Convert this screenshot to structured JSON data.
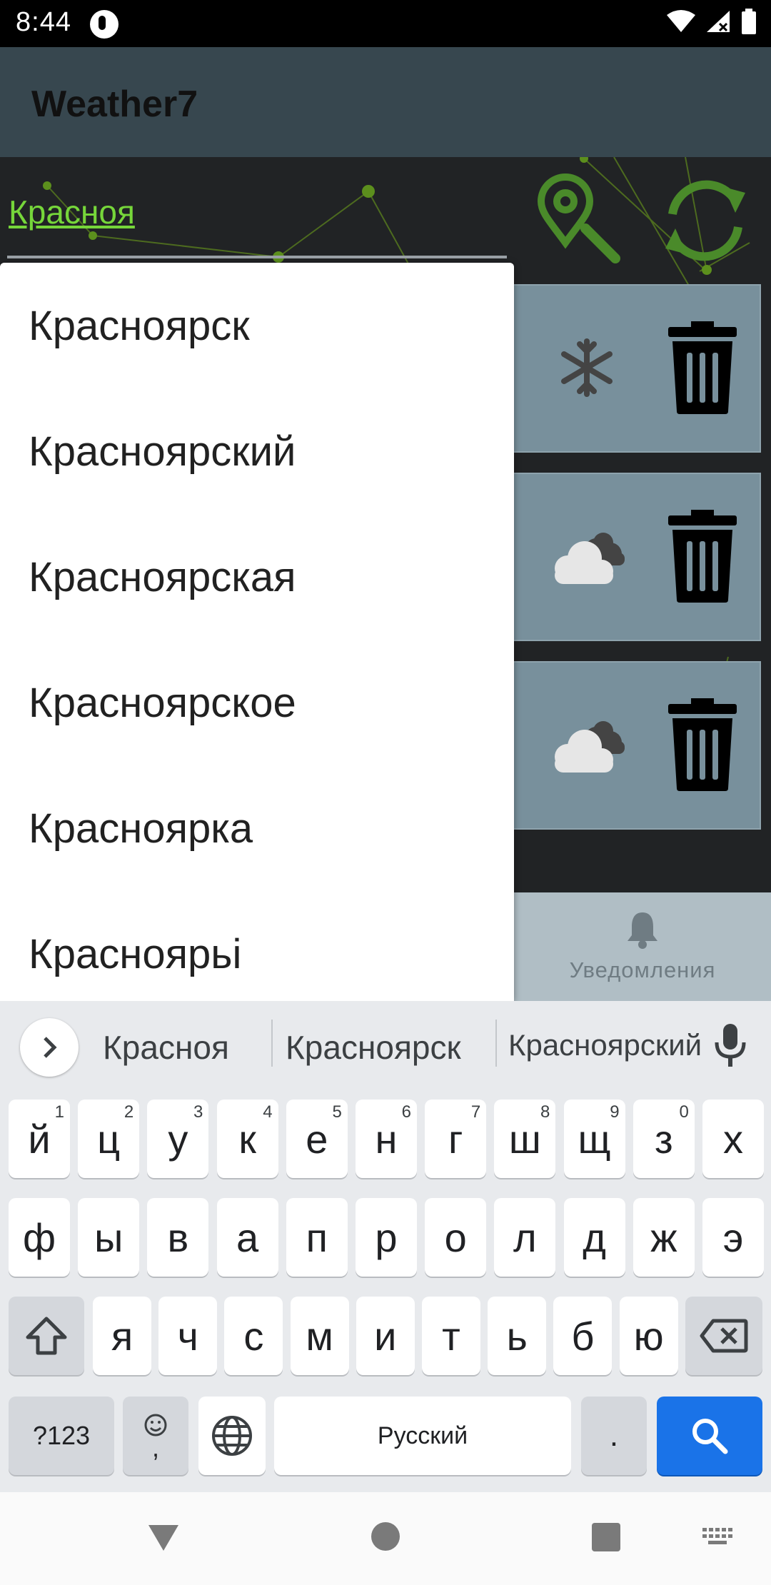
{
  "status_bar": {
    "time": "8:44"
  },
  "app": {
    "title": "Weather7"
  },
  "search": {
    "value": "Красноя"
  },
  "dropdown": {
    "items": [
      "Красноярск",
      "Красноярский",
      "Красноярская",
      "Красноярское",
      "Красноярка",
      "Красноярьі"
    ]
  },
  "bottom_nav": {
    "notifications_label": "Уведомления"
  },
  "keyboard": {
    "suggestions": [
      "Красноя",
      "Красноярск",
      "Красноярский"
    ],
    "row1": [
      {
        "k": "й",
        "h": "1"
      },
      {
        "k": "ц",
        "h": "2"
      },
      {
        "k": "у",
        "h": "3"
      },
      {
        "k": "к",
        "h": "4"
      },
      {
        "k": "е",
        "h": "5"
      },
      {
        "k": "н",
        "h": "6"
      },
      {
        "k": "г",
        "h": "7"
      },
      {
        "k": "ш",
        "h": "8"
      },
      {
        "k": "щ",
        "h": "9"
      },
      {
        "k": "з",
        "h": "0"
      },
      {
        "k": "х",
        "h": ""
      }
    ],
    "row2": [
      "ф",
      "ы",
      "в",
      "а",
      "п",
      "р",
      "о",
      "л",
      "д",
      "ж",
      "э"
    ],
    "row3": [
      "я",
      "ч",
      "с",
      "м",
      "и",
      "т",
      "ь",
      "б",
      "ю"
    ],
    "symbols_label": "?123",
    "comma_label": ",",
    "space_label": "Русский",
    "period_label": "."
  },
  "colors": {
    "accent_green": "#76d63a",
    "search_key": "#1a73e8"
  }
}
